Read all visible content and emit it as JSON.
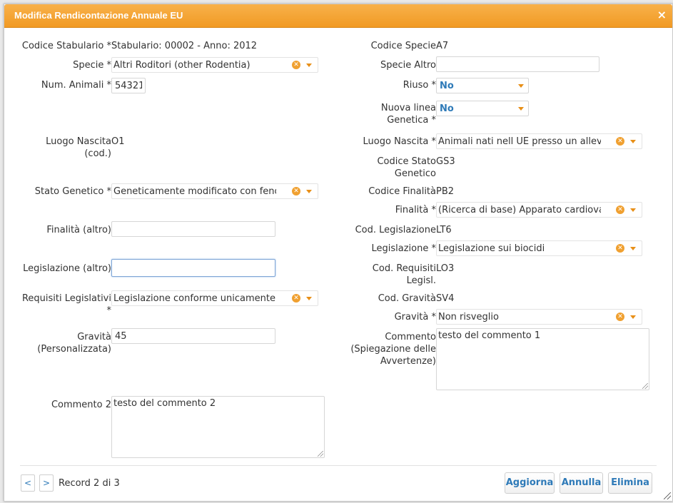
{
  "dialog": {
    "title": "Modifica Rendicontazione Annuale EU",
    "close": "×"
  },
  "left": {
    "codice_stabulario": {
      "label": "Codice Stabulario *",
      "value": "Stabulario: 00002 - Anno: 2012"
    },
    "specie": {
      "label": "Specie *",
      "value": "Altri Roditori (other Rodentia)"
    },
    "num_animali": {
      "label": "Num. Animali *",
      "value": "54321"
    },
    "luogo_nascita_cod": {
      "label_line1": "Luogo Nascita",
      "label_line2": "(cod.)",
      "value": "O1"
    },
    "stato_genetico": {
      "label": "Stato Genetico *",
      "value": "Geneticamente modificato con feno"
    },
    "finalita_altro": {
      "label": "Finalità (altro)",
      "value": ""
    },
    "legislazione_altro": {
      "label": "Legislazione (altro)",
      "value": ""
    },
    "requisiti_legislativi": {
      "label_line1": "Requisiti Legislativi",
      "label_line2": "*",
      "value": "Legislazione conforme unicamente"
    },
    "gravita_personalizzata": {
      "label_line1": "Gravità",
      "label_line2": "(Personalizzata)",
      "value": "45"
    },
    "commento2": {
      "label": "Commento 2",
      "value": "testo del commento 2"
    }
  },
  "right": {
    "codice_specie": {
      "label": "Codice Specie",
      "value": "A7"
    },
    "specie_altro": {
      "label": "Specie Altro",
      "value": ""
    },
    "riuso": {
      "label": "Riuso *",
      "value": "No"
    },
    "nuova_linea": {
      "label_line1": "Nuova linea",
      "label_line2": "Genetica *",
      "value": "No"
    },
    "luogo_nascita": {
      "label": "Luogo Nascita *",
      "value": "Animali nati nell UE presso un allev"
    },
    "codice_stato_genetico": {
      "label_line1": "Codice Stato",
      "label_line2": "Genetico",
      "value": "GS3"
    },
    "codice_finalita": {
      "label": "Codice Finalità",
      "value": "PB2"
    },
    "finalita": {
      "label": "Finalità *",
      "value": "(Ricerca di base) Apparato cardiova"
    },
    "cod_legislazione": {
      "label": "Cod. Legislazione",
      "value": "LT6"
    },
    "legislazione": {
      "label": "Legislazione *",
      "value": "Legislazione sui biocidi"
    },
    "cod_requisiti": {
      "label_line1": "Cod. Requisiti",
      "label_line2": "Legisl.",
      "value": "LO3"
    },
    "cod_gravita": {
      "label": "Cod. Gravità",
      "value": "SV4"
    },
    "gravita": {
      "label": "Gravità *",
      "value": "Non risveglio"
    },
    "commento": {
      "label_line1": "Commento",
      "label_line2": "(Spiegazione delle",
      "label_line3": "Avvertenze)",
      "value": "testo del commento 1"
    }
  },
  "footer": {
    "prev": "<",
    "next": ">",
    "record_text": "Record 2 di 3",
    "aggiorna": "Aggiorna",
    "annulla": "Annulla",
    "elimina": "Elimina"
  },
  "colors": {
    "accent": "#f19a24",
    "link": "#2e7ab8"
  },
  "icons": {
    "clear": "clear-icon",
    "dropdown": "chevron-down-icon"
  }
}
